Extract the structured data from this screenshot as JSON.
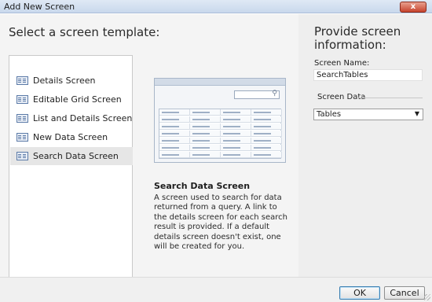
{
  "window": {
    "title": "Add New Screen",
    "close_glyph": "x"
  },
  "left": {
    "heading": "Select a screen template:",
    "templates": [
      {
        "label": "Details Screen",
        "icon": "details-screen-icon"
      },
      {
        "label": "Editable Grid Screen",
        "icon": "grid-screen-icon"
      },
      {
        "label": "List and Details Screen",
        "icon": "list-details-icon"
      },
      {
        "label": "New Data Screen",
        "icon": "new-data-icon"
      },
      {
        "label": "Search Data Screen",
        "icon": "search-data-icon",
        "selected": true
      }
    ],
    "preview": {
      "search_glyph": "⚲"
    },
    "description": {
      "title": "Search Data Screen",
      "text": "A screen used to search for data returned from a query.  A link to the details screen for each search result is provided.  If a default details screen doesn't exist, one will be created for you."
    }
  },
  "right": {
    "heading": "Provide screen information:",
    "screen_name_label": "Screen Name:",
    "screen_name_value": "SearchTables",
    "screen_data_label": "Screen Data",
    "screen_data_value": "Tables",
    "dropdown_arrow": "▼"
  },
  "footer": {
    "ok_label": "OK",
    "cancel_label": "Cancel"
  },
  "colors": {
    "accent": "#3c7fb1",
    "close": "#c7432d"
  }
}
